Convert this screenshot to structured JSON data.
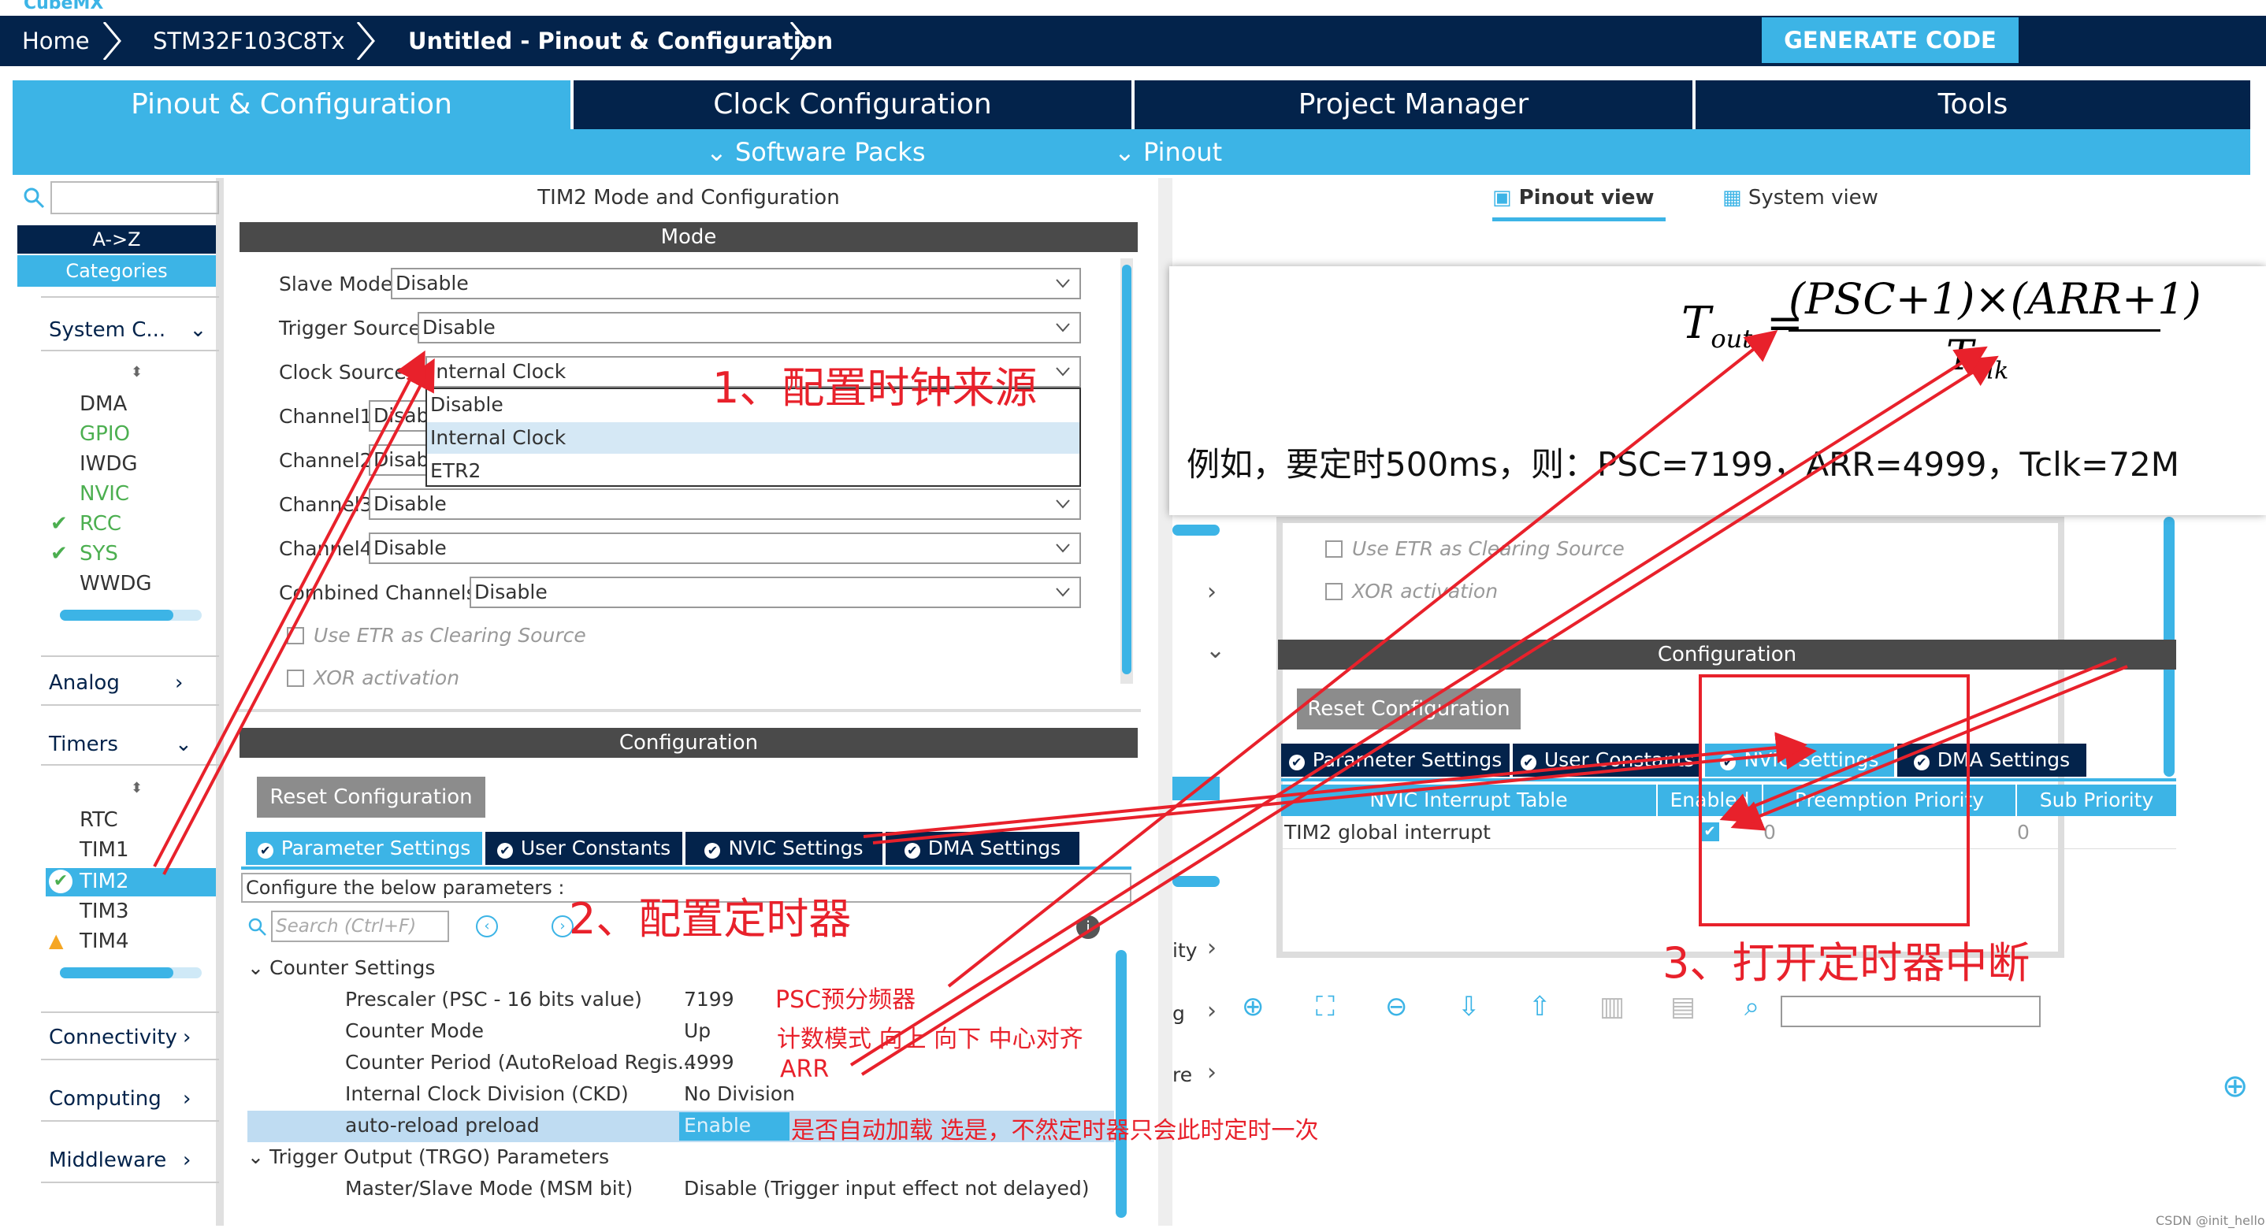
{
  "app": {
    "logo": "CubeMX"
  },
  "breadcrumb": {
    "home": "Home",
    "device": "STM32F103C8Tx",
    "project": "Untitled - Pinout & Configuration"
  },
  "generate_label": "GENERATE CODE",
  "main_tabs": [
    "Pinout & Configuration",
    "Clock Configuration",
    "Project Manager",
    "Tools"
  ],
  "sub_menu": {
    "software_packs": "Software Packs",
    "pinout": "Pinout"
  },
  "left": {
    "sort_az": "A->Z",
    "categories": "Categories",
    "system_core": "System C...",
    "items_system": [
      "DMA",
      "GPIO",
      "IWDG",
      "NVIC",
      "RCC",
      "SYS",
      "WWDG"
    ],
    "analog": "Analog",
    "timers": "Timers",
    "items_timers": [
      "RTC",
      "TIM1",
      "TIM2",
      "TIM3",
      "TIM4"
    ],
    "connectivity": "Connectivity",
    "computing": "Computing",
    "middleware": "Middleware"
  },
  "mid": {
    "title": "TIM2 Mode and Configuration",
    "mode_header": "Mode",
    "fields": [
      {
        "label": "Slave Mode",
        "value": "Disable"
      },
      {
        "label": "Trigger Source",
        "value": "Disable"
      },
      {
        "label": "Clock Source",
        "value": "Internal Clock"
      },
      {
        "label": "Channel1",
        "value": "Disab"
      },
      {
        "label": "Channel2",
        "value": "Disab"
      },
      {
        "label": "Channel3",
        "value": "Disable"
      },
      {
        "label": "Channel4",
        "value": "Disable"
      },
      {
        "label": "Combined Channels",
        "value": "Disable"
      }
    ],
    "dropdown_options": [
      "Disable",
      "Internal Clock",
      "ETR2"
    ],
    "use_etr": "Use ETR as Clearing Source",
    "xor": "XOR activation",
    "config_header": "Configuration",
    "reset_btn": "Reset Configuration",
    "tabs": [
      "Parameter Settings",
      "User Constants",
      "NVIC Settings",
      "DMA Settings"
    ],
    "configure_hint": "Configure the below parameters :",
    "search_placeholder": "Search (Ctrl+F)",
    "counter_settings": "Counter Settings",
    "params": [
      {
        "name": "Prescaler (PSC - 16 bits value)",
        "value": "7199"
      },
      {
        "name": "Counter Mode",
        "value": "Up"
      },
      {
        "name": "Counter Period (AutoReload Regis...",
        "value": "4999"
      },
      {
        "name": "Internal Clock Division (CKD)",
        "value": "No Division"
      },
      {
        "name": "auto-reload preload",
        "value": "Enable"
      }
    ],
    "trgo": "Trigger Output (TRGO) Parameters",
    "msm": {
      "name": "Master/Slave Mode (MSM bit)",
      "value": "Disable (Trigger input effect not delayed)"
    }
  },
  "right": {
    "pinout_view": "Pinout view",
    "system_view": "System view",
    "use_etr": "Use ETR as Clearing Source",
    "xor": "XOR activation",
    "config_header": "Configuration",
    "reset_btn": "Reset Configuration",
    "tabs": [
      "Parameter Settings",
      "User Constants",
      "NVIC Settings",
      "DMA Settings"
    ],
    "nvic_cols": [
      "NVIC Interrupt Table",
      "Enabled",
      "Preemption Priority",
      "Sub Priority"
    ],
    "nvic_row": {
      "name": "TIM2 global interrupt",
      "preempt": "0",
      "sub": "0"
    },
    "side_fragments": [
      "ity",
      "g",
      "re"
    ]
  },
  "formula": {
    "T": "T",
    "out": "out",
    "numerator": "(PSC+1)×(ARR+1)",
    "den_T": "T",
    "clk": "clk",
    "example": "例如，要定时500ms，则：PSC=7199，ARR=4999，Tclk=72M"
  },
  "annotations": {
    "a1": "1、配置时钟来源",
    "a2": "2、配置定时器",
    "a3": "3、打开定时器中断",
    "psc": "PSC预分频器",
    "mode": "计数模式  向上 向下 中心对齐",
    "arr": "ARR",
    "preload": "是否自动加载  选是，不然定时器只会此时定时一次"
  },
  "watermark": "CSDN @init_hello"
}
